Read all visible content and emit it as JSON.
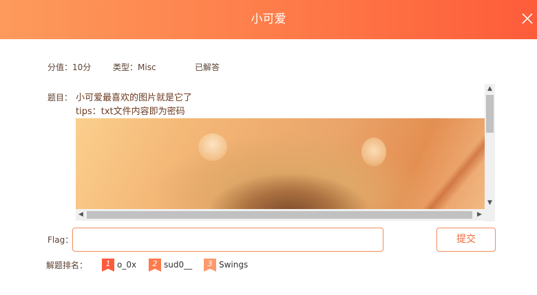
{
  "header": {
    "title": "小可爱",
    "close_icon": "close-icon",
    "colors": {
      "gradient_start": "#fd9a5c",
      "gradient_end": "#fe5c3a"
    }
  },
  "meta": {
    "score": "分值：10分",
    "type": "类型：Misc",
    "status": "已解答"
  },
  "problem": {
    "label": "题目：",
    "line1": "小可爱最喜欢的图片就是它了",
    "line2": "tips：txt文件内容即为密码"
  },
  "flag": {
    "label": "Flag：",
    "value": "",
    "placeholder": ""
  },
  "submit": {
    "label": "提交"
  },
  "ranking": {
    "label": "解题排名：",
    "entries": [
      {
        "rank": "1",
        "name": "o_0x",
        "color": "#fd5a3c"
      },
      {
        "rank": "2",
        "name": "sud0__",
        "color": "#fd7a4c"
      },
      {
        "rank": "3",
        "name": "Swings",
        "color": "#fd9a6c"
      }
    ]
  },
  "accent_color": "#f08a5a"
}
